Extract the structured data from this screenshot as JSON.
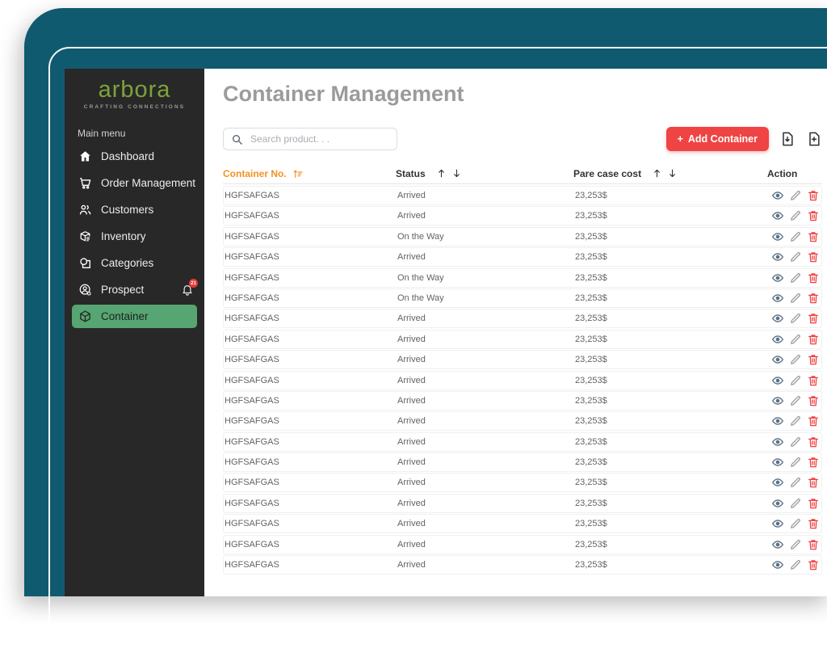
{
  "colors": {
    "frame_teal": "#105a70",
    "sidebar_bg": "#282828",
    "active_green": "#56a572",
    "logo_green": "#7da33b",
    "accent_orange": "#f29224",
    "accent_red": "#ef4444",
    "title_gray": "#9b9b9b"
  },
  "sidebar": {
    "logo_text": "arbora",
    "logo_tagline": "CRAFTING CONNECTIONS",
    "section_label": "Main menu",
    "items": [
      {
        "icon": "home-icon",
        "label": "Dashboard"
      },
      {
        "icon": "cart-icon",
        "label": "Order Management"
      },
      {
        "icon": "customers-icon",
        "label": "Customers"
      },
      {
        "icon": "inventory-icon",
        "label": "Inventory"
      },
      {
        "icon": "categories-icon",
        "label": "Categories"
      },
      {
        "icon": "prospect-icon",
        "label": "Prospect",
        "badge": "21",
        "badge_icon": "bell-icon"
      },
      {
        "icon": "container-icon",
        "label": "Container",
        "active": true
      }
    ]
  },
  "header": {
    "title": "Container Management"
  },
  "toolbar": {
    "search_placeholder": "Search product. . .",
    "add_button_plus": "+",
    "add_button_label": "Add Container",
    "file_icons": [
      "file-download-icon",
      "file-add-icon"
    ]
  },
  "table": {
    "columns": [
      {
        "label": "Container No.",
        "sort_icon": "sort-asc-icon",
        "color": "#f29224"
      },
      {
        "label": "Status",
        "sort": "up-down"
      },
      {
        "label": "Pare case cost",
        "sort": "up-down"
      },
      {
        "label": "Action"
      }
    ],
    "row_action_icons": [
      "eye-icon",
      "pencil-icon",
      "trash-icon"
    ],
    "rows": [
      {
        "container_no": "HGFSAFGAS",
        "status": "Arrived",
        "cost": "23,253$"
      },
      {
        "container_no": "HGFSAFGAS",
        "status": "Arrived",
        "cost": "23,253$"
      },
      {
        "container_no": "HGFSAFGAS",
        "status": "On the Way",
        "cost": "23,253$"
      },
      {
        "container_no": "HGFSAFGAS",
        "status": "Arrived",
        "cost": "23,253$"
      },
      {
        "container_no": "HGFSAFGAS",
        "status": "On the Way",
        "cost": "23,253$"
      },
      {
        "container_no": "HGFSAFGAS",
        "status": "On the Way",
        "cost": "23,253$"
      },
      {
        "container_no": "HGFSAFGAS",
        "status": "Arrived",
        "cost": "23,253$"
      },
      {
        "container_no": "HGFSAFGAS",
        "status": "Arrived",
        "cost": "23,253$"
      },
      {
        "container_no": "HGFSAFGAS",
        "status": "Arrived",
        "cost": "23,253$"
      },
      {
        "container_no": "HGFSAFGAS",
        "status": "Arrived",
        "cost": "23,253$"
      },
      {
        "container_no": "HGFSAFGAS",
        "status": "Arrived",
        "cost": "23,253$"
      },
      {
        "container_no": "HGFSAFGAS",
        "status": "Arrived",
        "cost": "23,253$"
      },
      {
        "container_no": "HGFSAFGAS",
        "status": "Arrived",
        "cost": "23,253$"
      },
      {
        "container_no": "HGFSAFGAS",
        "status": "Arrived",
        "cost": "23,253$"
      },
      {
        "container_no": "HGFSAFGAS",
        "status": "Arrived",
        "cost": "23,253$"
      },
      {
        "container_no": "HGFSAFGAS",
        "status": "Arrived",
        "cost": "23,253$"
      },
      {
        "container_no": "HGFSAFGAS",
        "status": "Arrived",
        "cost": "23,253$"
      },
      {
        "container_no": "HGFSAFGAS",
        "status": "Arrived",
        "cost": "23,253$"
      },
      {
        "container_no": "HGFSAFGAS",
        "status": "Arrived",
        "cost": "23,253$"
      }
    ]
  }
}
